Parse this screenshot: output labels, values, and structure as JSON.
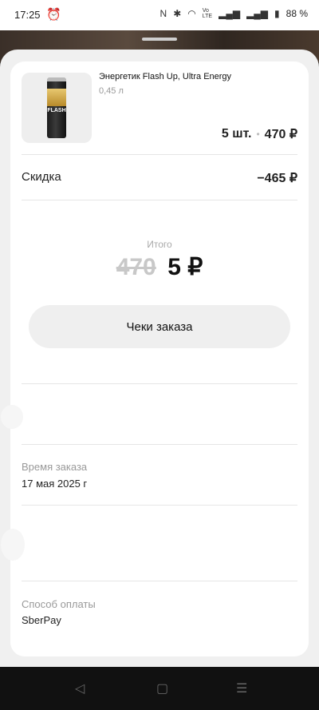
{
  "status_bar": {
    "time": "17:25",
    "battery": "88 %",
    "icons": [
      "alarm-icon",
      "nfc-icon",
      "bluetooth-icon",
      "wifi-icon",
      "volte-icon",
      "signal-icon",
      "signal-icon",
      "battery-icon"
    ]
  },
  "order": {
    "product_name": "Энергетик Flash Up, Ultra Energy",
    "product_volume": "0,45 л",
    "quantity": "5 шт.",
    "price": "470 ₽",
    "can_logo": "FLASH"
  },
  "discount": {
    "label": "Скидка",
    "value": "−465 ₽"
  },
  "total": {
    "caption": "Итого",
    "old_value": "470",
    "new_value": "5 ₽"
  },
  "receipts_button": "Чеки заказа",
  "details": {
    "order_time_label": "Время заказа",
    "order_time_value": "17 мая 2025 г",
    "payment_label": "Способ оплаты",
    "payment_value": "SberPay"
  },
  "nav": {
    "back": "◁",
    "home": "▢",
    "menu": "☰"
  },
  "colors": {
    "accent_text": "#111111",
    "muted": "#999999",
    "sheet_bg": "#f0f0f0"
  }
}
